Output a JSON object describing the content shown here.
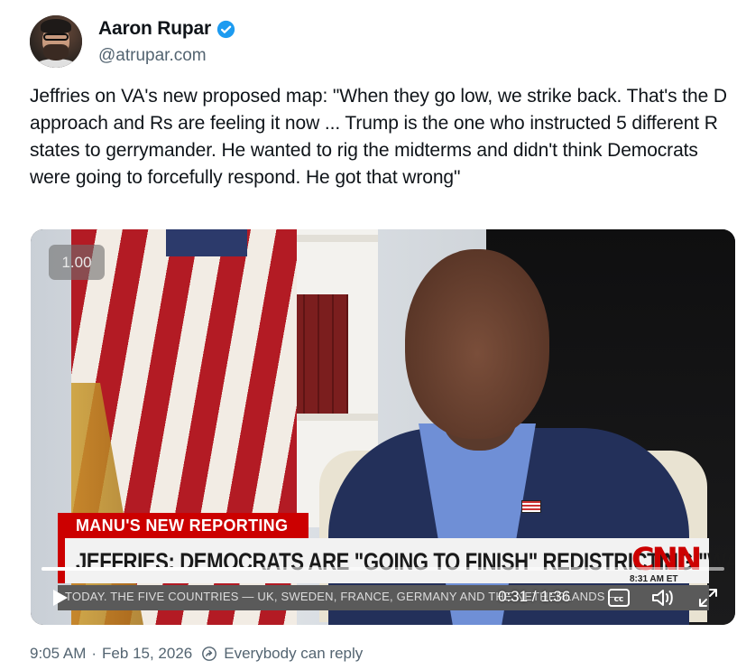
{
  "author": {
    "display_name": "Aaron Rupar",
    "handle": "@atrupar.com",
    "verified": true
  },
  "tweet": {
    "text": "Jeffries on VA's new proposed map: \"When they go low, we strike back. That's the D approach and Rs are feeling it now ... Trump is the one who instructed 5 different R states to gerrymander. He wanted to rig the midterms and didn't think Democrats were going to forcefully respond. He got that wrong\""
  },
  "video": {
    "playback_speed": "1.00",
    "kicker": "MANU'S NEW REPORTING",
    "headline": "JEFFRIES: DEMOCRATS ARE \"GOING TO FINISH\" REDISTRICTING \"WAR\"",
    "network_logo": "CNN",
    "network_time": "8:31 AM ET",
    "ticker": "TODAY. THE FIVE COUNTRIES — UK, SWEDEN, FRANCE, GERMANY AND THE NETHERLANDS —",
    "current_time": "0:31",
    "duration": "1:36",
    "time_display": "0:31 / 1:36",
    "progress_fraction": 0.323
  },
  "footer": {
    "time": "9:05 AM",
    "separator": "·",
    "date": "Feb 15, 2026",
    "reply_setting": "Everybody can reply"
  },
  "colors": {
    "verified": "#1d9bf0",
    "cnn_red": "#cc0000",
    "muted_text": "#536471"
  }
}
